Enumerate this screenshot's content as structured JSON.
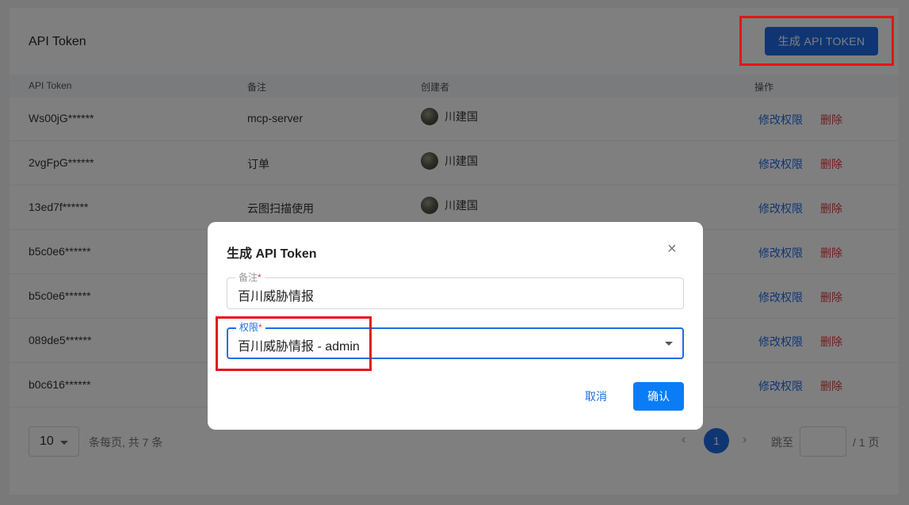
{
  "header": {
    "title": "API Token",
    "generate_button": "生成 API TOKEN"
  },
  "table": {
    "columns": [
      "API Token",
      "备注",
      "创建者",
      "操作"
    ],
    "rows": [
      {
        "token": "Ws00jG******",
        "note": "mcp-server",
        "creator": "川建国",
        "edit": "修改权限",
        "delete": "删除"
      },
      {
        "token": "2vgFpG******",
        "note": "订单",
        "creator": "川建国",
        "edit": "修改权限",
        "delete": "删除"
      },
      {
        "token": "13ed7f******",
        "note": "云图扫描使用",
        "creator": "川建国",
        "edit": "修改权限",
        "delete": "删除"
      },
      {
        "token": "b5c0e6******",
        "note": "",
        "creator": "",
        "edit": "修改权限",
        "delete": "删除"
      },
      {
        "token": "b5c0e6******",
        "note": "",
        "creator": "",
        "edit": "修改权限",
        "delete": "删除"
      },
      {
        "token": "089de5******",
        "note": "",
        "creator": "",
        "edit": "修改权限",
        "delete": "删除"
      },
      {
        "token": "b0c616******",
        "note": "",
        "creator": "",
        "edit": "修改权限",
        "delete": "删除"
      }
    ]
  },
  "pagination": {
    "page_size": "10",
    "per_page_text": "条每页, 共 7 条",
    "current_page": "1",
    "jump_label": "跳至",
    "total_pages_text": "/ 1 页"
  },
  "modal": {
    "title": "生成 API Token",
    "close_glyph": "×",
    "note_label": "备注",
    "note_value": "百川威胁情报",
    "permission_label": "权限",
    "permission_value": "百川威胁情报 - admin",
    "required_mark": "*",
    "cancel_label": "取消",
    "confirm_label": "确认"
  },
  "glyphs": {
    "prev": "‹",
    "next": "›"
  },
  "colors": {
    "primary": "#1e6de6",
    "danger": "#e03c3c",
    "highlight": "#e4141b"
  }
}
